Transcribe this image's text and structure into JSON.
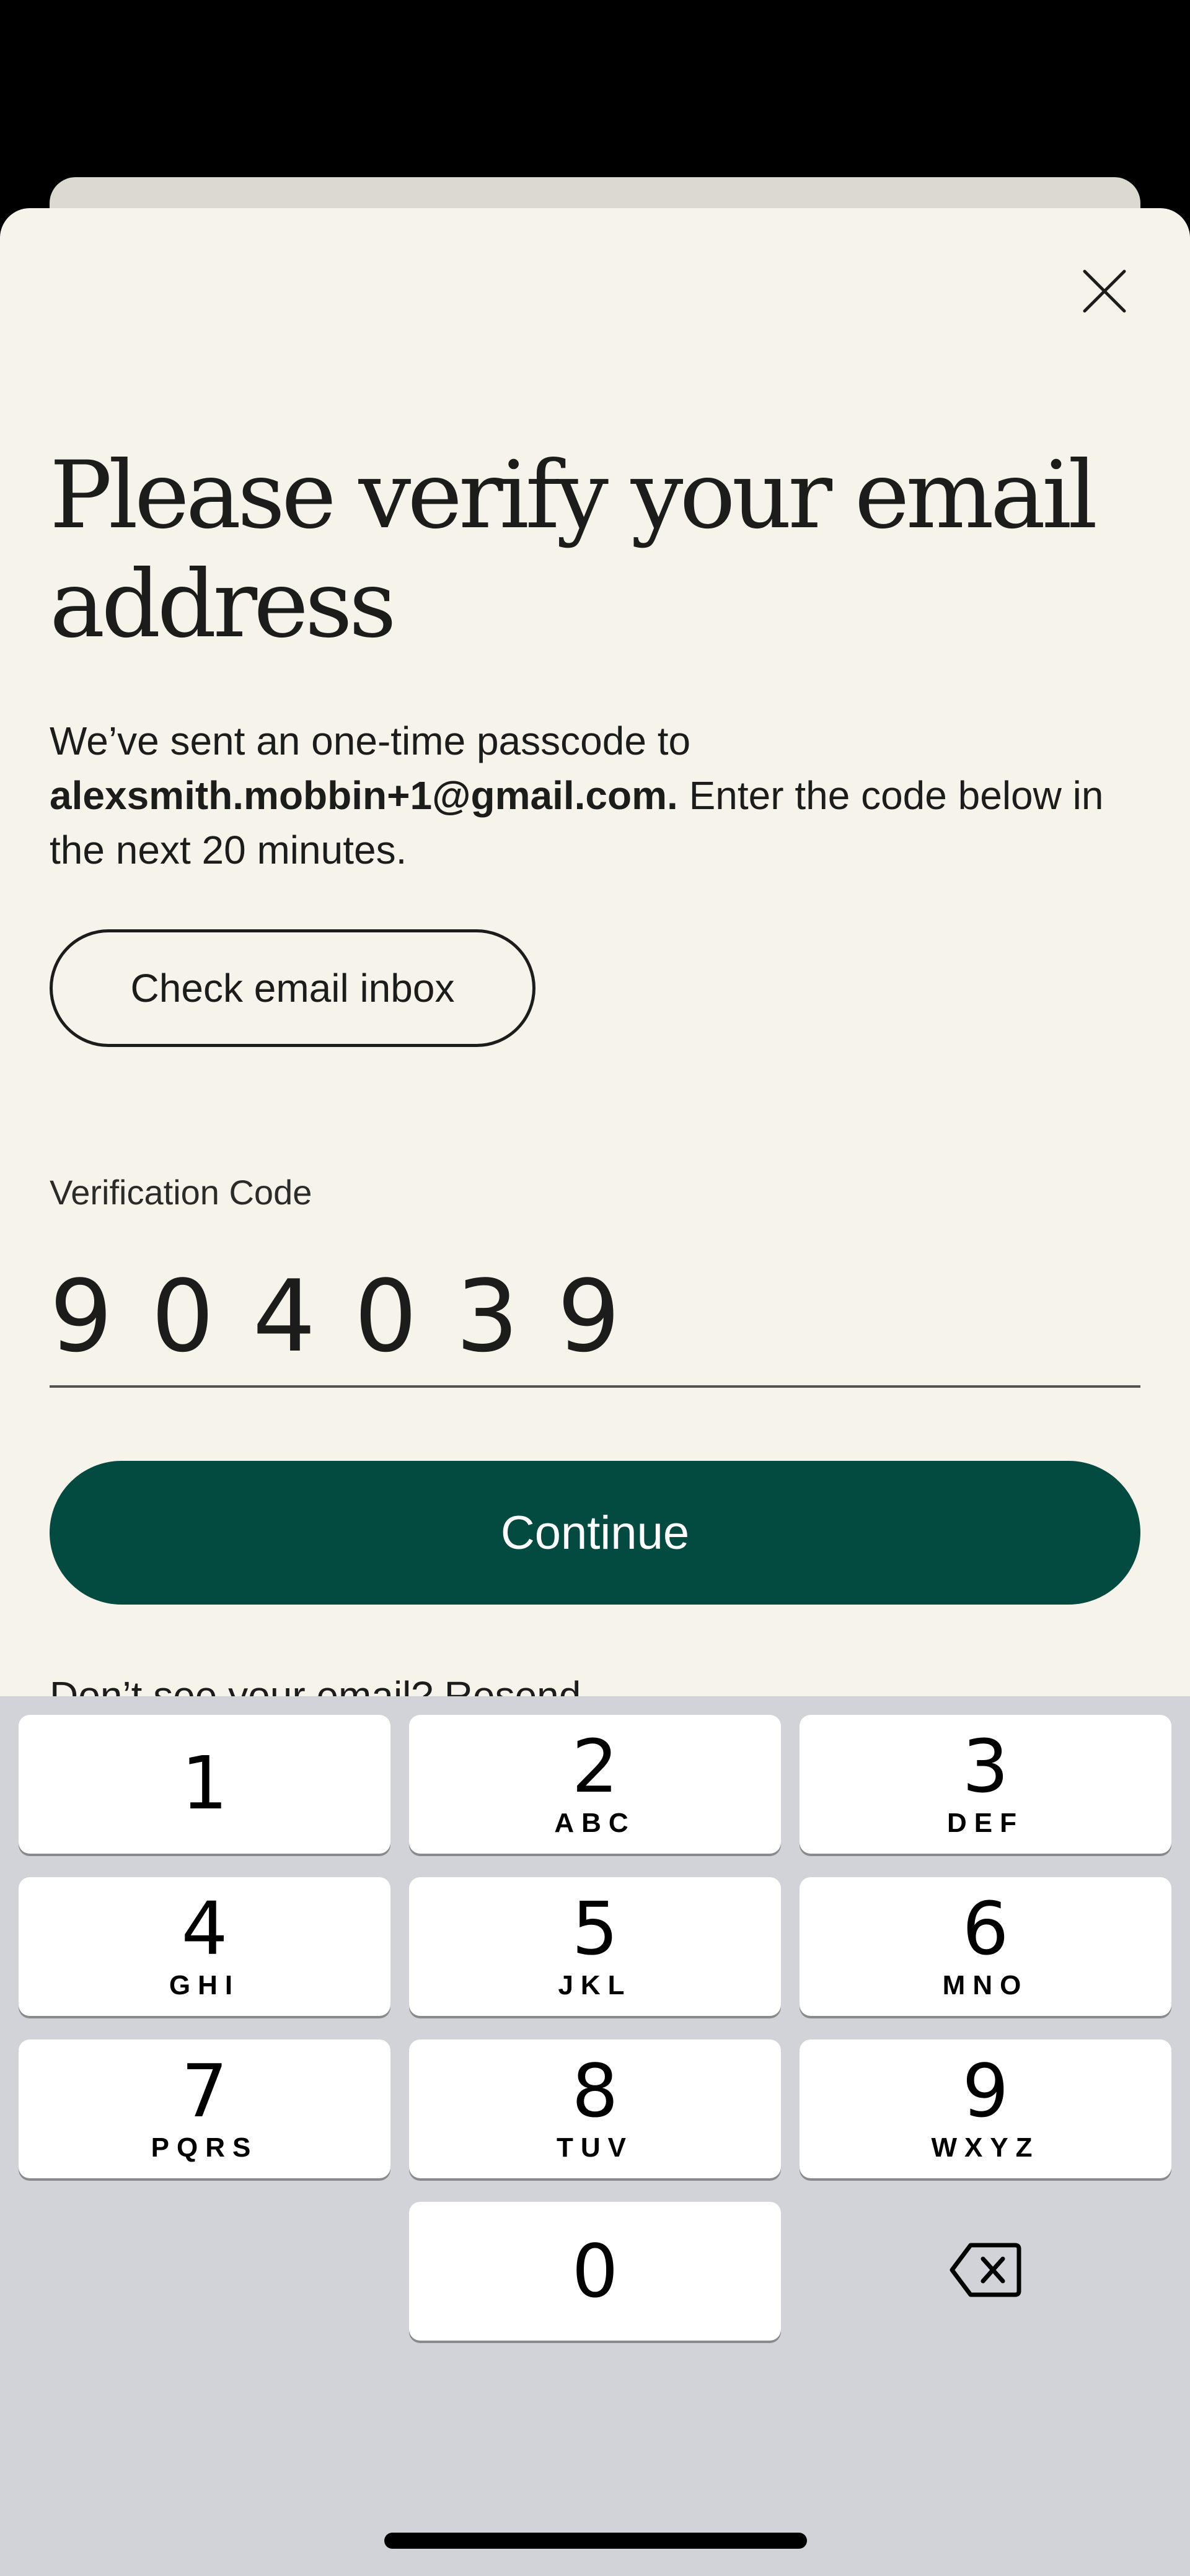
{
  "sheet": {
    "title": "Please verify your email address",
    "description_prefix": "We’ve sent an one-time passcode to ",
    "email": "alexsmith.mobbin+1@gmail.com.",
    "description_suffix": " Enter the code below in the next 20 minutes.",
    "check_inbox_label": "Check email inbox",
    "close_icon": "close-icon"
  },
  "verification": {
    "label": "Verification Code",
    "value": "904039"
  },
  "continue_label": "Continue",
  "resend_text": "Don’t see your email? Resend",
  "keyboard": {
    "keys": [
      {
        "digit": "1",
        "letters": ""
      },
      {
        "digit": "2",
        "letters": "ABC"
      },
      {
        "digit": "3",
        "letters": "DEF"
      },
      {
        "digit": "4",
        "letters": "GHI"
      },
      {
        "digit": "5",
        "letters": "JKL"
      },
      {
        "digit": "6",
        "letters": "MNO"
      },
      {
        "digit": "7",
        "letters": "PQRS"
      },
      {
        "digit": "8",
        "letters": "TUV"
      },
      {
        "digit": "9",
        "letters": "WXYZ"
      },
      {
        "digit": "0",
        "letters": ""
      }
    ],
    "backspace_icon": "backspace-icon"
  },
  "colors": {
    "sheet_background": "#f6f4ea",
    "primary_button": "#034a40",
    "keyboard_background": "#d2d3d9"
  }
}
